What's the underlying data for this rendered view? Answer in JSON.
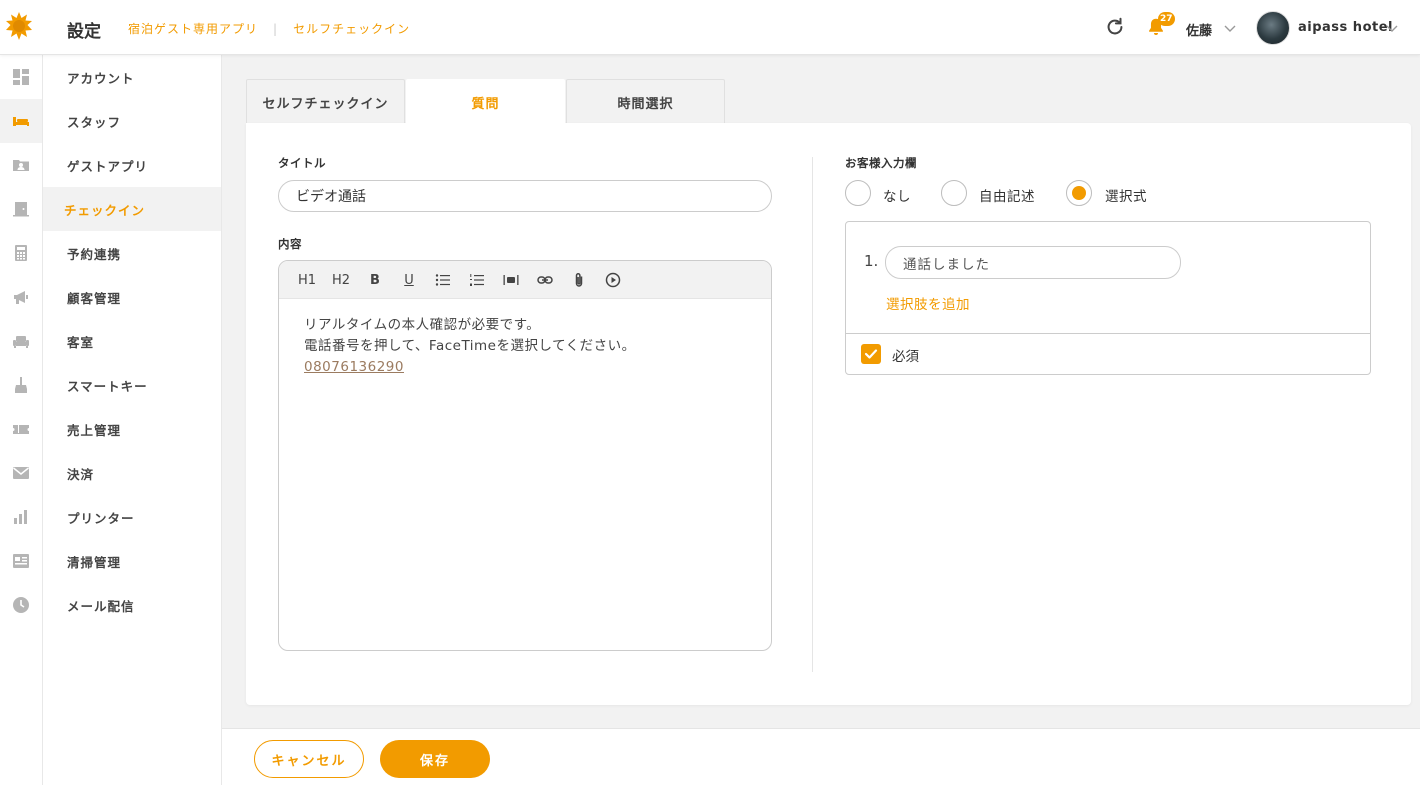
{
  "header": {
    "title": "設定",
    "breadcrumb": [
      "宿泊ゲスト専用アプリ",
      "セルフチェックイン"
    ],
    "notification_count": "27",
    "user_name": "佐藤",
    "hotel_name": "aipass hotel"
  },
  "rail": {
    "icons": [
      "dashboard-icon",
      "bed-icon",
      "guest-card-icon",
      "door-icon",
      "calculator-icon",
      "megaphone-icon",
      "sofa-icon",
      "cleaning-icon",
      "ticket-icon",
      "mail-icon",
      "bar-chart-icon",
      "list-icon",
      "clock-icon"
    ],
    "active_index": 1
  },
  "menu": {
    "items": [
      "アカウント",
      "スタッフ",
      "ゲストアプリ",
      "チェックイン",
      "予約連携",
      "顧客管理",
      "客室",
      "スマートキー",
      "売上管理",
      "決済",
      "プリンター",
      "清掃管理",
      "メール配信"
    ],
    "active_index": 3
  },
  "tabs": [
    "セルフチェックイン",
    "質問",
    "時間選択"
  ],
  "active_tab": 1,
  "form": {
    "title_label": "タイトル",
    "title_value": "ビデオ通話",
    "content_label": "内容",
    "toolbar": [
      "H1",
      "H2",
      "B",
      "U"
    ],
    "content_lines": [
      "リアルタイムの本人確認が必要です。",
      "電話番号を押して、FaceTimeを選択してください。"
    ],
    "content_phone": "08076136290"
  },
  "answer": {
    "label": "お客様入力欄",
    "options": [
      "なし",
      "自由記述",
      "選択式"
    ],
    "selected": "選択式",
    "choices": [
      {
        "number": "1.",
        "value": "通話しました"
      }
    ],
    "add_choice_label": "選択肢を追加",
    "required_label": "必須",
    "required_checked": true
  },
  "footer": {
    "cancel_label": "キャンセル",
    "save_label": "保存"
  },
  "colors": {
    "accent": "#f29b00",
    "rail_icon": "#b5b5b5"
  }
}
